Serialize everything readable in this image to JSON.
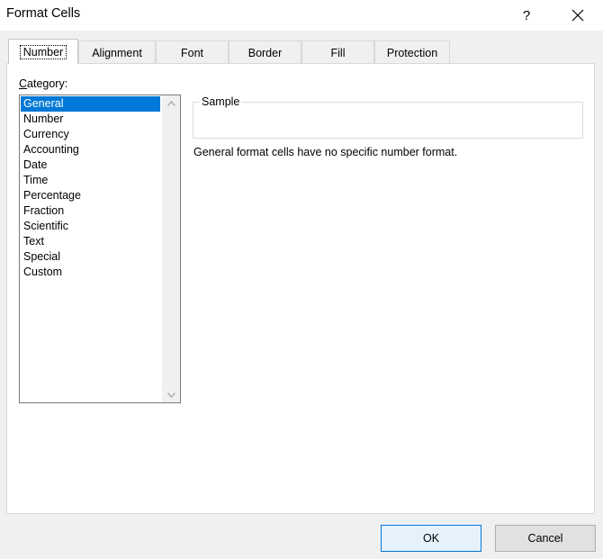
{
  "window": {
    "title": "Format Cells",
    "help_label": "?"
  },
  "tabs": [
    {
      "label": "Number",
      "active": true
    },
    {
      "label": "Alignment",
      "active": false
    },
    {
      "label": "Font",
      "active": false
    },
    {
      "label": "Border",
      "active": false
    },
    {
      "label": "Fill",
      "active": false
    },
    {
      "label": "Protection",
      "active": false
    }
  ],
  "number_tab": {
    "category_label_accel": "C",
    "category_label_rest": "ategory:",
    "categories": [
      "General",
      "Number",
      "Currency",
      "Accounting",
      "Date",
      "Time",
      "Percentage",
      "Fraction",
      "Scientific",
      "Text",
      "Special",
      "Custom"
    ],
    "selected_index": 0,
    "sample_label": "Sample",
    "sample_value": "",
    "description": "General format cells have no specific number format."
  },
  "buttons": {
    "ok": "OK",
    "cancel": "Cancel"
  },
  "colors": {
    "selection": "#0078d7",
    "ok_border": "#0078d7"
  }
}
